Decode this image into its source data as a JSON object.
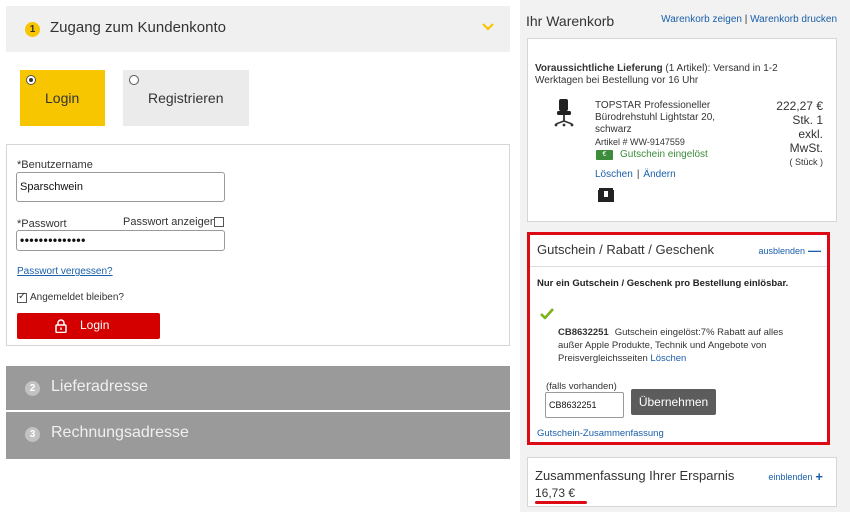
{
  "checkout": {
    "step1": {
      "number": "1",
      "title": "Zugang zum Kundenkonto"
    },
    "options": {
      "login": "Login",
      "register": "Registrieren"
    },
    "form": {
      "username_label": "*Benutzername",
      "username_value": "Sparschwein",
      "password_label": "*Passwort",
      "show_password_label": "Passwort anzeigen",
      "password_value": "••••••••••••••",
      "forgot_password": "Passwort vergessen?",
      "stay_logged_in": "Angemeldet bleiben?",
      "login_button": "Login"
    },
    "step2": {
      "number": "2",
      "title": "Lieferadresse"
    },
    "step3": {
      "number": "3",
      "title": "Rechnungsadresse"
    }
  },
  "cart": {
    "title": "Ihr Warenkorb",
    "show_link": "Warenkorb zeigen",
    "separator": "|",
    "print_link": "Warenkorb drucken",
    "delivery_bold": "Voraussichtliche Lieferung",
    "delivery_rest": " (1 Artikel): Versand in 1-2 Werktagen bei Bestellung vor 16 Uhr",
    "product": {
      "name": "TOPSTAR Professioneller Bürodrehstuhl Lightstar 20, schwarz",
      "article": "Artikel # WW-9147559",
      "voucher_badge": "€",
      "voucher_applied": "Gutschein eingelöst",
      "delete": "Löschen",
      "separator": "|",
      "change": "Ändern",
      "price": "222,27 €",
      "qty": "Stk. 1",
      "tax": "exkl.",
      "tax2": "MwSt.",
      "unit": "( Stück )"
    }
  },
  "voucher": {
    "title": "Gutschein / Rabatt / Geschenk",
    "toggle": "ausblenden",
    "toggle_mark": "—",
    "note": "Nur ein Gutschein / Geschenk pro Bestellung einlösbar.",
    "code": "CB8632251",
    "description": "Gutschein eingelöst:7% Rabatt auf alles außer Apple Produkte, Technik und Angebote von Preisvergleichsseiten",
    "delete": "Löschen",
    "input_label": "(falls vorhanden)",
    "input_value": "CB8632251",
    "apply_button": "Übernehmen",
    "summary_link": "Gutschein-Zusammenfassung"
  },
  "savings": {
    "title": "Zusammenfassung Ihrer Ersparnis",
    "toggle": "einblenden",
    "toggle_mark": "+",
    "amount": "16,73 €"
  },
  "colors": {
    "accent_yellow": "#f7c600",
    "login_red": "#d40000",
    "highlight_red": "#dc0a14",
    "link_blue": "#1a5faa",
    "voucher_green": "#3c8c3c"
  }
}
